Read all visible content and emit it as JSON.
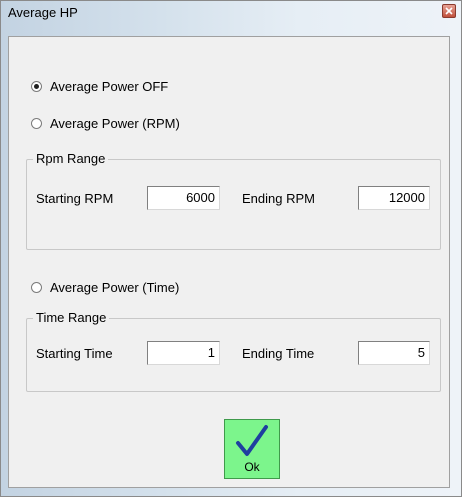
{
  "window": {
    "title": "Average HP"
  },
  "options": {
    "off_label": "Average Power OFF",
    "rpm_label": "Average Power (RPM)",
    "time_label": "Average Power (Time)",
    "selected": "off"
  },
  "rpm_range": {
    "title": "Rpm Range",
    "start_label": "Starting RPM",
    "start_value": "6000",
    "end_label": "Ending RPM",
    "end_value": "12000"
  },
  "time_range": {
    "title": "Time Range",
    "start_label": "Starting Time",
    "start_value": "1",
    "end_label": "Ending Time",
    "end_value": "5"
  },
  "ok_button": {
    "label": "Ok",
    "icon": "checkmark-icon"
  },
  "colors": {
    "ok_bg": "#7cf58c",
    "checkmark": "#1f3fa0",
    "close_bg": "#c0503c"
  }
}
